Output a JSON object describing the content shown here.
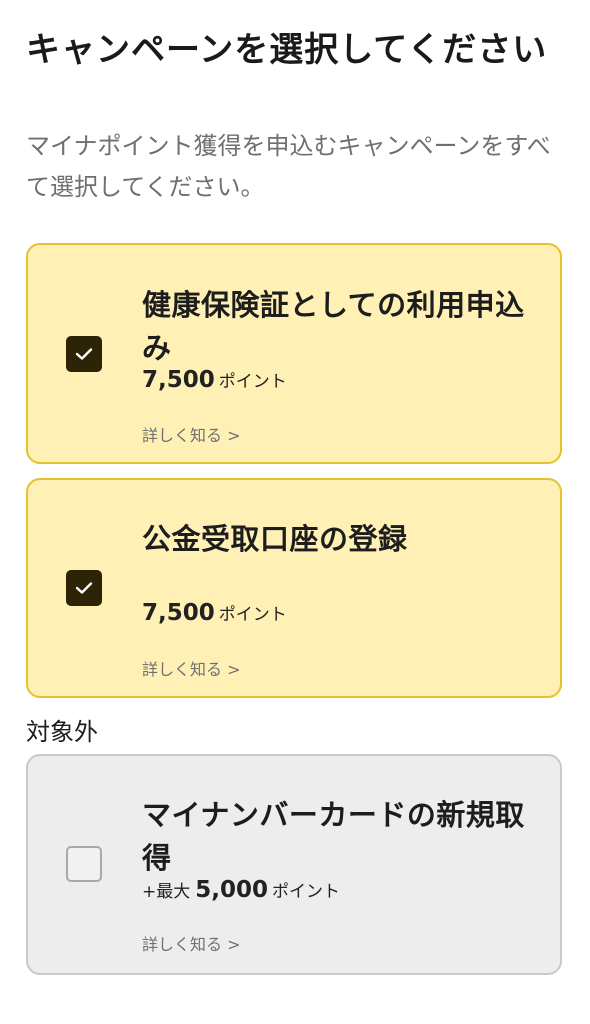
{
  "page": {
    "title": "キャンペーンを選択してください",
    "description": "マイナポイント獲得を申込むキャンペーンをすべて選択してください。"
  },
  "colors": {
    "selected_background": "#fff1b6",
    "selected_border": "#e6c12e",
    "checkbox_checked": "#2d2305",
    "excluded_background": "#ededed",
    "excluded_border": "#c9c9c9"
  },
  "campaigns": [
    {
      "title": "健康保険証としての利用申込み",
      "points_prefix": "",
      "points_amount": "7,500",
      "points_unit": "ポイント",
      "details_link": "詳しく知る >",
      "checked": true
    },
    {
      "title": "公金受取口座の登録",
      "points_prefix": "",
      "points_amount": "7,500",
      "points_unit": "ポイント",
      "details_link": "詳しく知る >",
      "checked": true
    }
  ],
  "excluded_section": {
    "label": "対象外",
    "campaigns": [
      {
        "title": "マイナンバーカードの新規取得",
        "points_prefix": "+最大",
        "points_amount": "5,000",
        "points_unit": "ポイント",
        "details_link": "詳しく知る >",
        "checked": false
      }
    ]
  },
  "icons": {
    "checkmark": "check-icon"
  }
}
